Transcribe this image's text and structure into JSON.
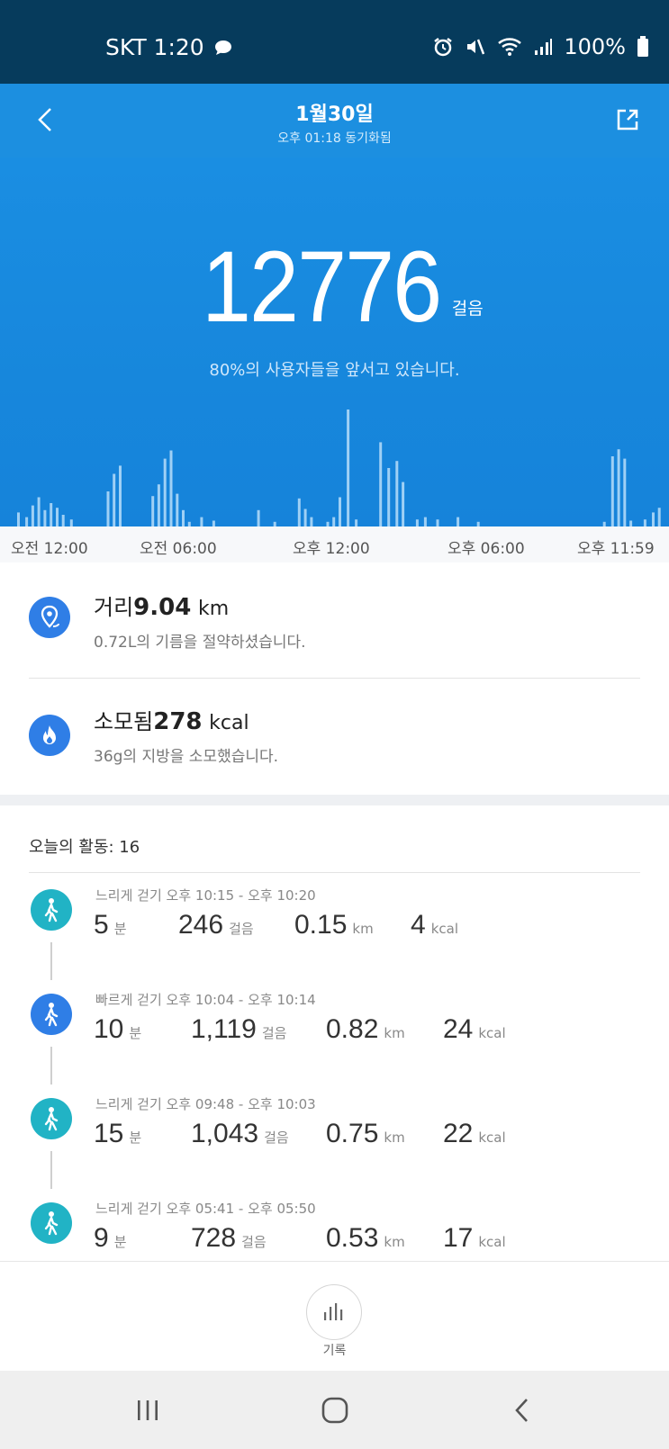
{
  "status_bar": {
    "carrier_time": "SKT 1:20",
    "battery": "100%",
    "icons": [
      "chat-bubble-icon",
      "alarm-icon",
      "mute-icon",
      "wifi-icon",
      "signal-icon",
      "battery-icon"
    ]
  },
  "header": {
    "title": "1월30일",
    "sync": "오후 01:18 동기화됨"
  },
  "hero": {
    "steps": "12776",
    "steps_unit": "걸음",
    "percentile": "80%의 사용자들을 앞서고 있습니다.",
    "chart_color": "#9fd0f5"
  },
  "chart_data": {
    "type": "bar",
    "description_axis": "time of day",
    "x_labels": [
      "오전 12:00",
      "오전 06:00",
      "오후 12:00",
      "오후 06:00",
      "오후 11:59"
    ],
    "values": [
      {
        "t": 12.2,
        "v": 12
      },
      {
        "t": 12.4,
        "v": 8
      },
      {
        "t": 12.55,
        "v": 18
      },
      {
        "t": 12.7,
        "v": 25
      },
      {
        "t": 12.85,
        "v": 14
      },
      {
        "t": 13.0,
        "v": 20
      },
      {
        "t": 13.15,
        "v": 16
      },
      {
        "t": 13.3,
        "v": 10
      },
      {
        "t": 13.5,
        "v": 6
      },
      {
        "t": 14.4,
        "v": 30
      },
      {
        "t": 14.55,
        "v": 45
      },
      {
        "t": 14.7,
        "v": 52
      },
      {
        "t": 15.5,
        "v": 26
      },
      {
        "t": 15.65,
        "v": 36
      },
      {
        "t": 15.8,
        "v": 58
      },
      {
        "t": 15.95,
        "v": 65
      },
      {
        "t": 16.1,
        "v": 28
      },
      {
        "t": 16.25,
        "v": 14
      },
      {
        "t": 16.4,
        "v": 4
      },
      {
        "t": 16.7,
        "v": 8
      },
      {
        "t": 17.0,
        "v": 5
      },
      {
        "t": 18.1,
        "v": 14
      },
      {
        "t": 18.5,
        "v": 4
      },
      {
        "t": 19.1,
        "v": 24
      },
      {
        "t": 19.25,
        "v": 15
      },
      {
        "t": 19.4,
        "v": 8
      },
      {
        "t": 19.8,
        "v": 4
      },
      {
        "t": 19.95,
        "v": 8
      },
      {
        "t": 20.1,
        "v": 25
      },
      {
        "t": 20.3,
        "v": 100
      },
      {
        "t": 20.5,
        "v": 6
      },
      {
        "t": 21.1,
        "v": 72
      },
      {
        "t": 21.3,
        "v": 50
      },
      {
        "t": 21.5,
        "v": 56
      },
      {
        "t": 21.65,
        "v": 38
      },
      {
        "t": 22.0,
        "v": 6
      },
      {
        "t": 22.2,
        "v": 8
      },
      {
        "t": 22.5,
        "v": 6
      },
      {
        "t": 23.0,
        "v": 8
      },
      {
        "t": 23.5,
        "v": 4
      },
      {
        "t": 26.6,
        "v": 4
      },
      {
        "t": 26.8,
        "v": 60
      },
      {
        "t": 26.95,
        "v": 66
      },
      {
        "t": 27.1,
        "v": 58
      },
      {
        "t": 27.25,
        "v": 5
      },
      {
        "t": 27.6,
        "v": 6
      },
      {
        "t": 27.8,
        "v": 12
      },
      {
        "t": 27.95,
        "v": 16
      }
    ],
    "x_range": [
      12,
      28
    ],
    "ylim": [
      0,
      100
    ]
  },
  "summary": {
    "distance_label": "거리",
    "distance_value": "9.04",
    "distance_unit": "km",
    "distance_sub": "0.72L의 기름을 절약하셨습니다.",
    "calories_label": "소모됨",
    "calories_value": "278",
    "calories_unit": "kcal",
    "calories_sub": "36g의 지방을 소모했습니다."
  },
  "activities": {
    "header": "오늘의 활동:  16",
    "items": [
      {
        "title": "느리게 걷기 오후 10:15 - 오후 10:20",
        "minutes": "5",
        "steps": "246",
        "km": "0.15",
        "kcal": "4",
        "color": "#21b3c5"
      },
      {
        "title": "빠르게 걷기 오후 10:04 - 오후 10:14",
        "minutes": "10",
        "steps": "1,119",
        "km": "0.82",
        "kcal": "24",
        "color": "#2f7ee6"
      },
      {
        "title": "느리게 걷기 오후 09:48 - 오후 10:03",
        "minutes": "15",
        "steps": "1,043",
        "km": "0.75",
        "kcal": "22",
        "color": "#21b3c5"
      },
      {
        "title": "느리게 걷기 오후 05:41 - 오후 05:50",
        "minutes": "9",
        "steps": "728",
        "km": "0.53",
        "kcal": "17",
        "color": "#21b3c5"
      }
    ],
    "units": {
      "min": "분",
      "steps": "걸음",
      "km": "km",
      "kcal": "kcal"
    }
  },
  "bottom": {
    "record_label": "기록"
  }
}
